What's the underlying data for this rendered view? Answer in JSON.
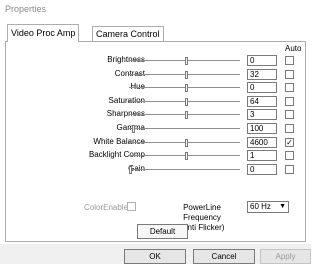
{
  "window": {
    "title": "Properties"
  },
  "tabs": [
    {
      "label": "Video Proc Amp"
    },
    {
      "label": "Camera Control"
    }
  ],
  "auto_header": "Auto",
  "controls": [
    {
      "label": "Brightness",
      "value": "0",
      "auto": false,
      "slider": 0.5
    },
    {
      "label": "Contrast",
      "value": "32",
      "auto": false,
      "slider": 0.5
    },
    {
      "label": "Hue",
      "value": "0",
      "auto": false,
      "slider": 0.5
    },
    {
      "label": "Saturation",
      "value": "64",
      "auto": false,
      "slider": 0.5
    },
    {
      "label": "Sharpness",
      "value": "3",
      "auto": false,
      "slider": 0.5
    },
    {
      "label": "Gamma",
      "value": "100",
      "auto": false,
      "slider": 0.03
    },
    {
      "label": "White Balance",
      "value": "4600",
      "auto": true,
      "slider": 0.5
    },
    {
      "label": "Backlight Comp",
      "value": "1",
      "auto": false,
      "slider": 0.5
    },
    {
      "label": "Gain",
      "value": "0",
      "auto": false,
      "slider": 0.0
    }
  ],
  "colorenable": {
    "label": "ColorEnable"
  },
  "powerline": {
    "label_line1": "PowerLine Frequency",
    "label_line2": "(Anti Flicker)",
    "value": "60 Hz"
  },
  "buttons": {
    "default": "Default",
    "ok": "OK",
    "cancel": "Cancel",
    "apply": "Apply"
  }
}
